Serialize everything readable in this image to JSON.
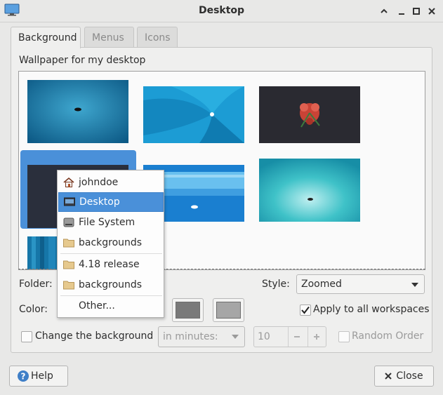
{
  "window": {
    "title": "Desktop"
  },
  "tabs": [
    {
      "label": "Background",
      "active": true
    },
    {
      "label": "Menus",
      "active": false
    },
    {
      "label": "Icons",
      "active": false
    }
  ],
  "background": {
    "section_label": "Wallpaper for my desktop",
    "folder_label": "Folder:",
    "color_label": "Color:",
    "style_label": "Style:",
    "style_value": "Zoomed",
    "apply_all_label": "Apply to all workspaces",
    "apply_all_checked": true,
    "change_bg_label": "Change the background",
    "change_bg_checked": false,
    "interval_value": "in minutes:",
    "interval_number": "10",
    "random_label": "Random Order",
    "random_checked": false,
    "primary_color": "#7a7a7a",
    "secondary_color": "#a6a6a6"
  },
  "folder_menu": {
    "items": [
      {
        "label": "johndoe",
        "icon": "home-icon"
      },
      {
        "label": "Desktop",
        "icon": "desktop-icon",
        "selected": true
      },
      {
        "label": "File System",
        "icon": "drive-icon"
      },
      {
        "label": "backgrounds",
        "icon": "folder-icon"
      },
      {
        "label": "4.18 release",
        "icon": "folder-icon"
      },
      {
        "label": "backgrounds",
        "icon": "folder-icon"
      },
      {
        "label": "Other...",
        "icon": ""
      }
    ]
  },
  "buttons": {
    "help": "Help",
    "close": "Close"
  },
  "colors": {
    "accent": "#4a90d9",
    "window_bg": "#e8e8e7"
  }
}
